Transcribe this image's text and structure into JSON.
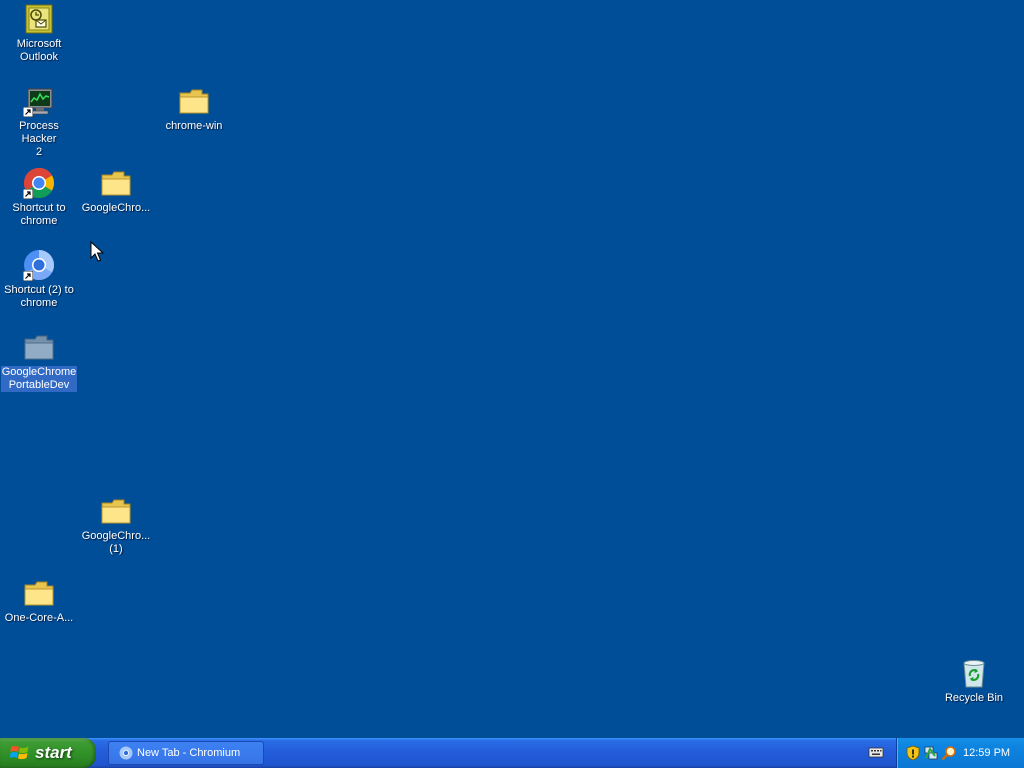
{
  "desktop": {
    "background_color": "#004e98",
    "icons": [
      {
        "label": "Microsoft\nOutlook",
        "icon": "outlook-icon"
      },
      {
        "label": "Process Hacker\n2",
        "icon": "process-hacker-icon"
      },
      {
        "label": "chrome-win",
        "icon": "folder-icon"
      },
      {
        "label": "Shortcut to\nchrome",
        "icon": "chrome-icon"
      },
      {
        "label": "GoogleChro...",
        "icon": "folder-icon"
      },
      {
        "label": "Shortcut (2) to\nchrome",
        "icon": "chromium-icon"
      },
      {
        "label": "GoogleChrome\nPortableDev",
        "icon": "folder-icon",
        "selected": true
      },
      {
        "label": "GoogleChro...\n(1)",
        "icon": "folder-icon"
      },
      {
        "label": "One-Core-A...",
        "icon": "folder-icon"
      },
      {
        "label": "Recycle Bin",
        "icon": "recycle-bin-icon"
      }
    ]
  },
  "taskbar": {
    "start_label": "start",
    "tasks": [
      {
        "label": "New Tab - Chromium",
        "icon": "chromium-icon"
      }
    ],
    "tray_icons": [
      "security-shield-icon",
      "network-icon",
      "search-icon"
    ],
    "clock": "12:59 PM"
  },
  "colors": {
    "desktop": "#004e98",
    "taskbar": "#245edb",
    "start_button": "#3c9b33",
    "tray": "#0b77d4",
    "selection": "#316ac5"
  }
}
